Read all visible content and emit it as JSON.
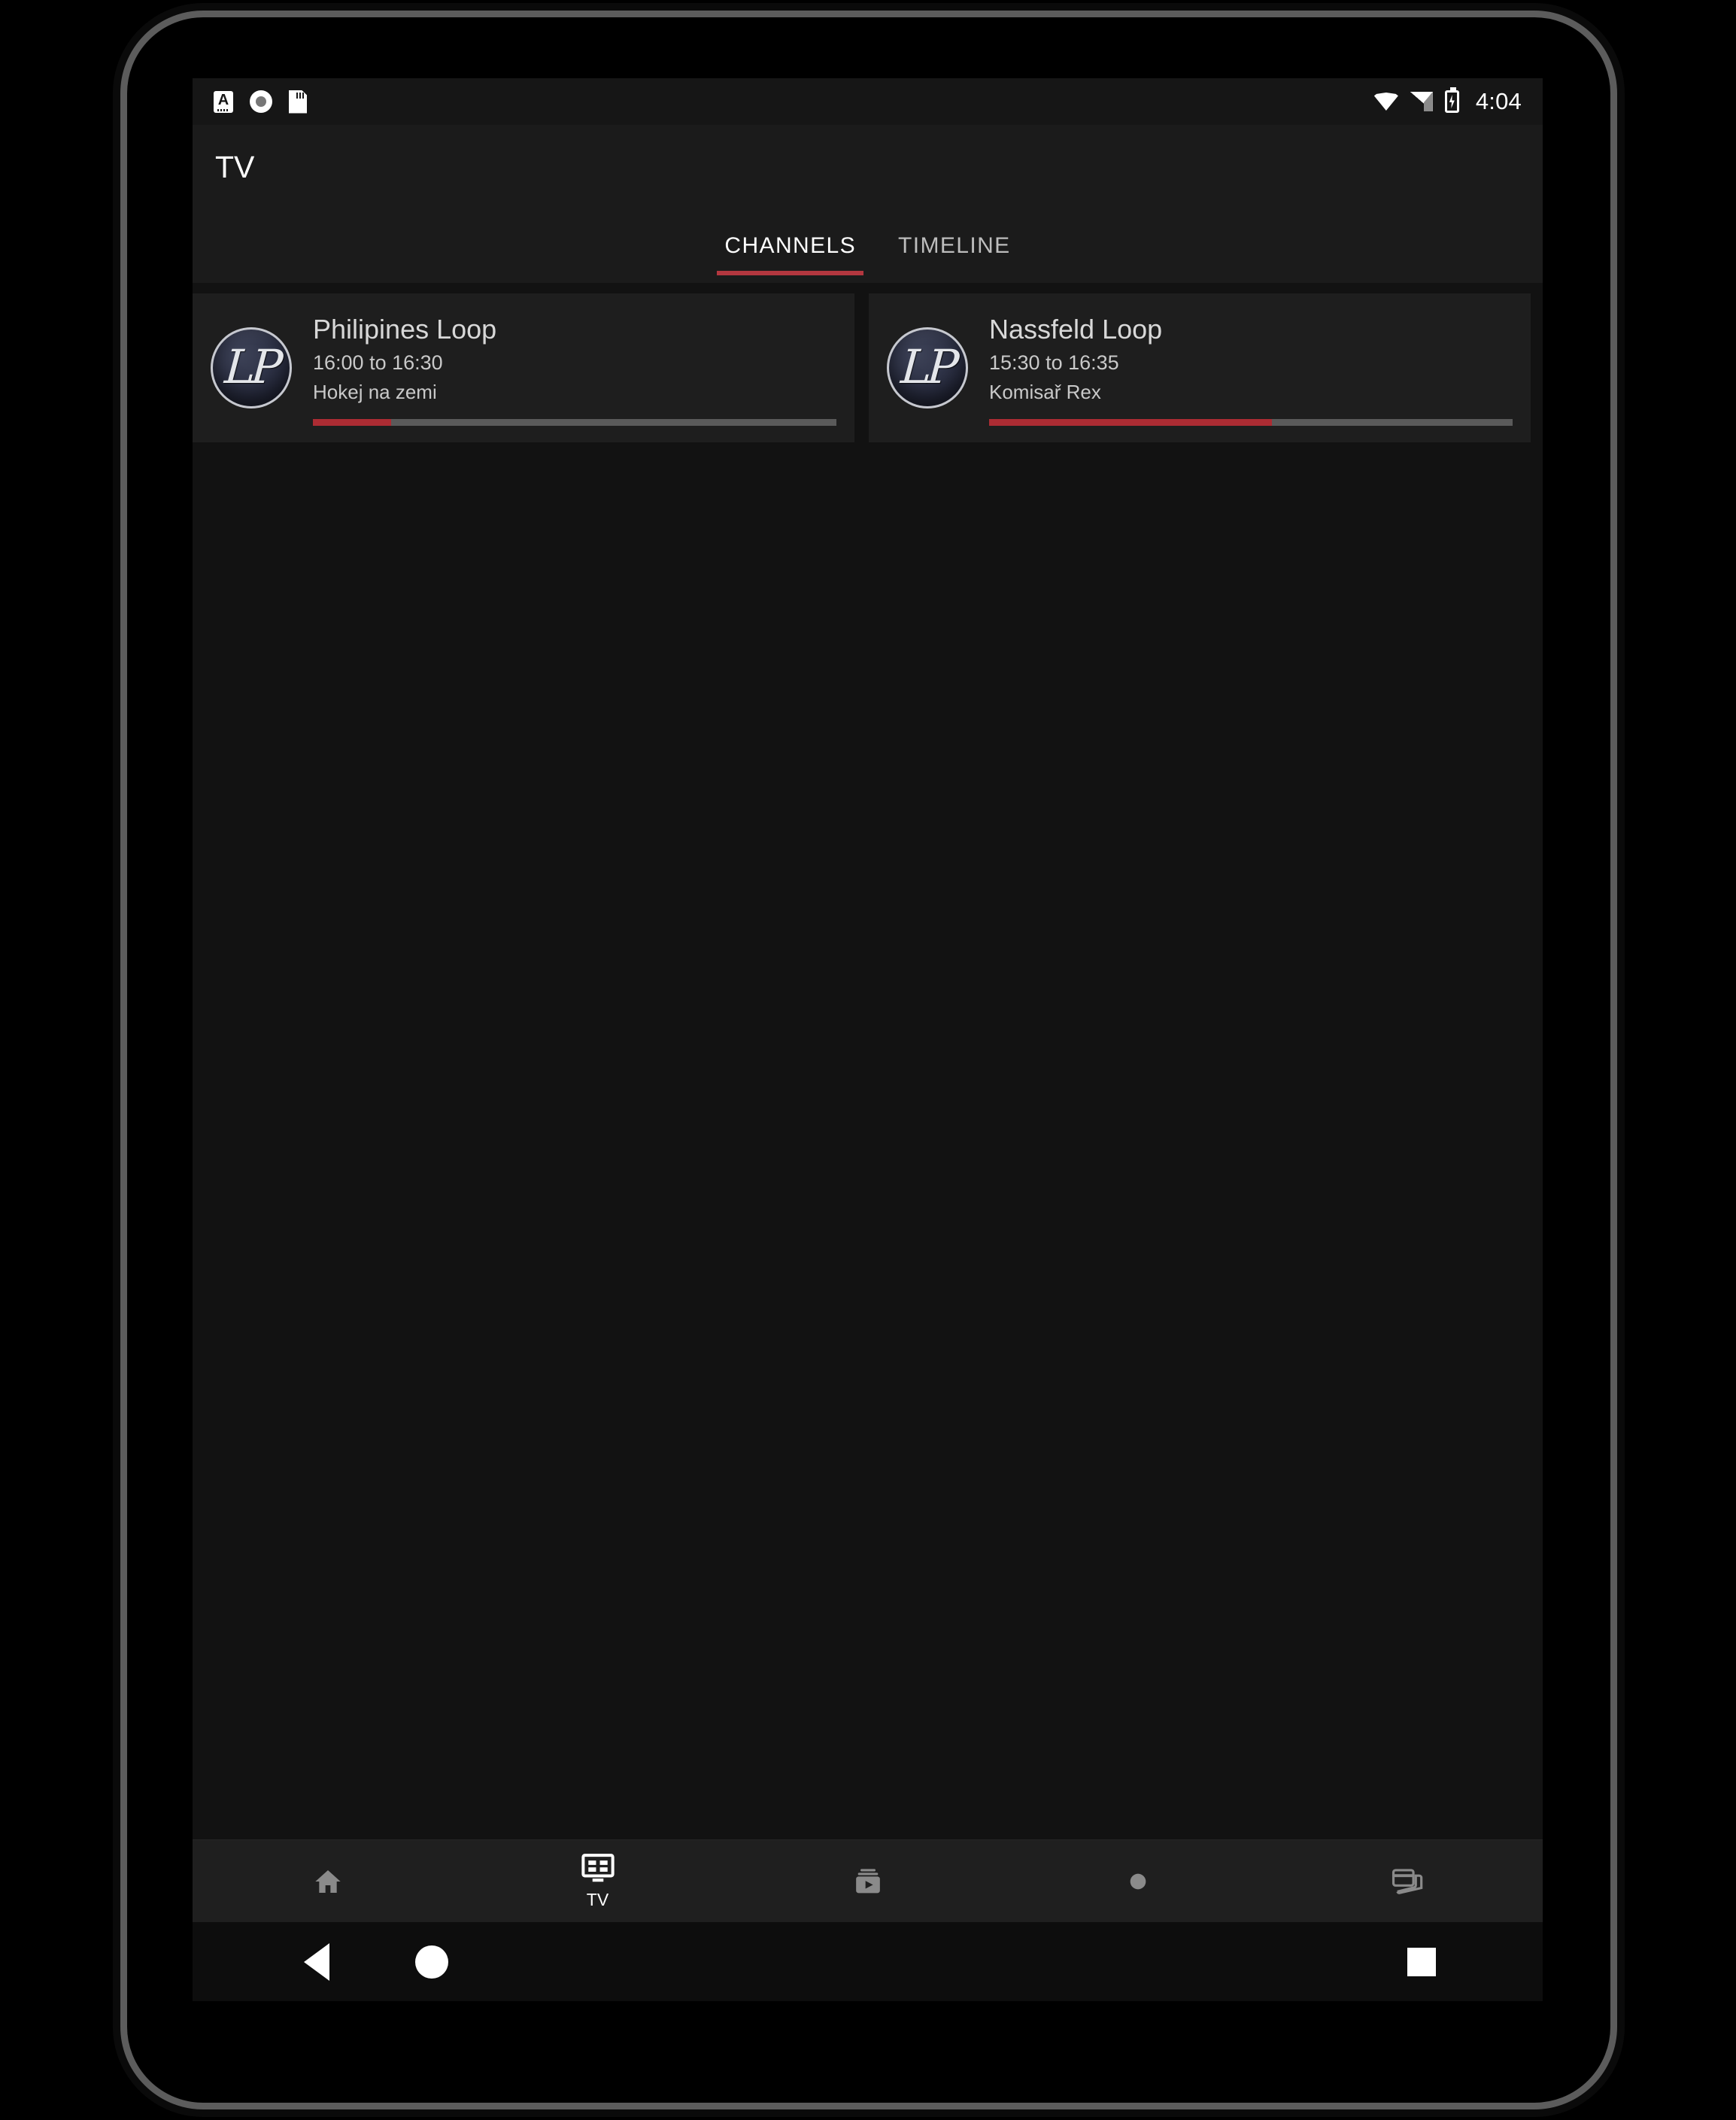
{
  "status_bar": {
    "icons_left": [
      "font-size-a-icon",
      "record-circle-icon",
      "sd-card-icon"
    ],
    "icons_right": [
      "wifi-icon",
      "cellular-signal-icon",
      "battery-charging-icon"
    ],
    "time": "4:04"
  },
  "appbar": {
    "title": "TV"
  },
  "tabs": [
    {
      "label": "CHANNELS",
      "active": true
    },
    {
      "label": "TIMELINE",
      "active": false
    }
  ],
  "colors": {
    "accent_red": "#b3373f",
    "progress_red": "#ac2c33",
    "progress_track": "#5a5a5a",
    "card_bg": "#1e1e1e",
    "appbar_bg": "#1b1b1b",
    "screen_bg": "#121212",
    "nav_bg": "#1f1f1f"
  },
  "channels": [
    {
      "logo": "lp-channel-logo",
      "logo_text": "LP",
      "name": "Philipines Loop",
      "time_range": "16:00 to 16:30",
      "program": "Hokej na zemi",
      "progress_percent": 15
    },
    {
      "logo": "lp-channel-logo",
      "logo_text": "LP",
      "name": "Nassfeld Loop",
      "time_range": "15:30 to 16:35",
      "program": "Komisař Rex",
      "progress_percent": 54
    }
  ],
  "bottom_nav": [
    {
      "icon": "home-icon",
      "label": "",
      "active": false
    },
    {
      "icon": "tv-guide-icon",
      "label": "TV",
      "active": true
    },
    {
      "icon": "video-library-icon",
      "label": "",
      "active": false
    },
    {
      "icon": "record-dot-icon",
      "label": "",
      "active": false
    },
    {
      "icon": "cards-stack-icon",
      "label": "",
      "active": false
    }
  ],
  "system_nav": {
    "back": "back-triangle-icon",
    "home": "home-circle-icon",
    "recents": "recents-square-icon"
  }
}
